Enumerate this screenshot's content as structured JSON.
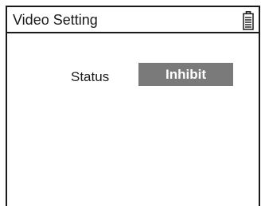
{
  "header": {
    "title": "Video Setting",
    "battery_icon": "battery-icon"
  },
  "main": {
    "status_label": "Status",
    "status_value": "Inhibit"
  },
  "colors": {
    "line": "#1a1a1a",
    "value_background": "#7a7a7a",
    "value_text": "#ffffff"
  }
}
